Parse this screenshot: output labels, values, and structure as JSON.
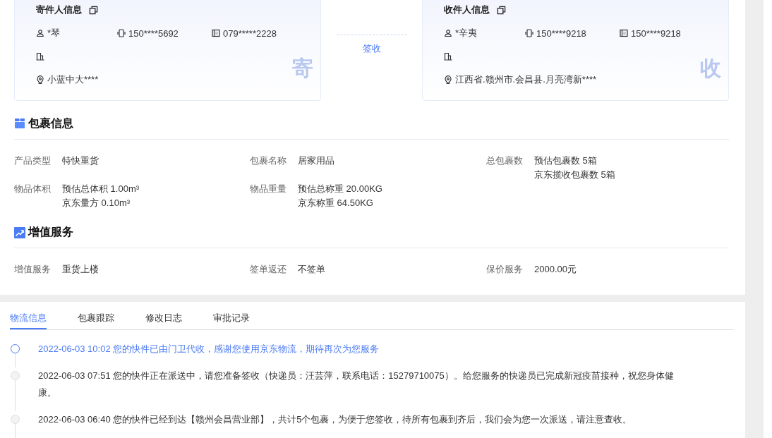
{
  "parties": [
    {
      "title": "寄件人信息",
      "name": "*琴",
      "mobile": "150****5692",
      "phone": "079*****2228",
      "address": "小蓝中大****",
      "stamp": "寄"
    },
    {
      "title": "收件人信息",
      "name": "*辛夷",
      "mobile": "150****9218",
      "phone": "150****9218",
      "address": "江西省.赣州市.会昌县.月亮湾新****",
      "stamp": "收"
    }
  ],
  "status": "签收",
  "sections": [
    {
      "kind": "package",
      "title": "包裹信息",
      "fields": [
        {
          "label": "产品类型",
          "values": [
            "特快重货"
          ]
        },
        {
          "label": "包裹名称",
          "values": [
            "居家用品"
          ]
        },
        {
          "label": "总包裹数",
          "values": [
            "预估包裹数 5箱",
            "京东揽收包裹数 5箱"
          ]
        },
        {
          "label": "物品体积",
          "values": [
            "预估总体积 1.00m³",
            "京东量方 0.10m³"
          ]
        },
        {
          "label": "物品重量",
          "values": [
            "预估总称重 20.00KG",
            "京东称重 64.50KG"
          ]
        }
      ]
    },
    {
      "kind": "service",
      "title": "增值服务",
      "fields": [
        {
          "label": "增值服务",
          "values": [
            "重货上楼"
          ]
        },
        {
          "label": "签单返还",
          "values": [
            "不签单"
          ]
        },
        {
          "label": "保价服务",
          "values": [
            "2000.00元"
          ]
        }
      ]
    }
  ],
  "tabs": [
    {
      "label": "物流信息",
      "selected": true
    },
    {
      "label": "包裹跟踪",
      "selected": false
    },
    {
      "label": "修改日志",
      "selected": false
    },
    {
      "label": "审批记录",
      "selected": false
    }
  ],
  "timeline": [
    {
      "text": "2022-06-03 10:02 您的快件已由门卫代收，感谢您使用京东物流，期待再次为您服务",
      "active": true
    },
    {
      "text": "2022-06-03 07:51 您的快件正在派送中，请您准备签收（快递员：汪芸萍，联系电话：15279710075）。给您服务的快递员已完成新冠疫苗接种，祝您身体健康。",
      "active": false
    },
    {
      "text": "2022-06-03 06:40 您的快件已经到达【赣州会昌营业部】，共计5个包裹，为便于您签收，待所有包裹到齐后，我们会为您一次派送，请注意查收。",
      "active": false
    }
  ]
}
